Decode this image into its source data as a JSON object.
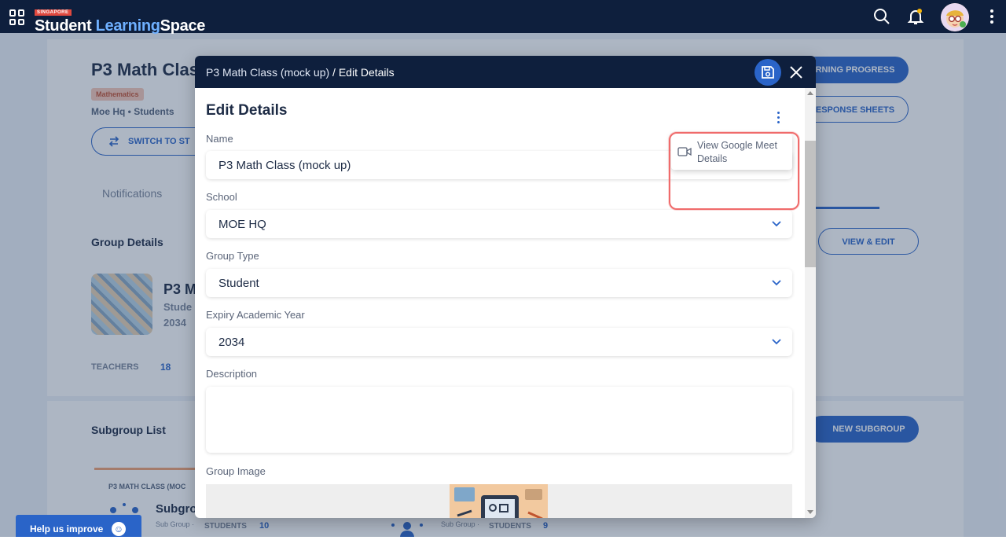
{
  "app": {
    "brand_tag": "SINGAPORE",
    "brand_part1": "Student",
    "brand_part2": "Learning",
    "brand_part3": "Space"
  },
  "background": {
    "group_title": "P3 Math Clas",
    "subject_tag": "Mathematics",
    "meta": "Moe Hq • Students",
    "switch_button": "SWITCH TO ST",
    "learning_progress_button": "RNING PROGRESS",
    "response_sheets_button": "ESPONSE SHEETS",
    "notifications_tab": "Notifications",
    "group_details_heading": "Group Details",
    "group_card_title": "P3 M",
    "group_card_sub1": "Stude",
    "group_card_sub2": "2034",
    "teachers_label": "TEACHERS",
    "teachers_count": "18",
    "view_edit_button": "VIEW & EDIT",
    "subgroup_list_heading": "Subgroup List",
    "new_subgroup_button": "NEW SUBGROUP",
    "subgroup_card_label": "P3 MATH CLASS (MOC",
    "subgroup_card_title": "Subgro",
    "subgroup_card_sub": "Sub Group ·",
    "students_label_1": "STUDENTS",
    "students_count_1": "10",
    "subgroup_card2_sub": "Sub Group ·",
    "students_label_2": "STUDENTS",
    "students_count_2": "9"
  },
  "help": {
    "label": "Help us improve",
    "emoji": "☺"
  },
  "modal": {
    "breadcrumb_parent": "P3 Math Class (mock up)",
    "breadcrumb_separator": " / ",
    "breadcrumb_current": "Edit Details",
    "section_title": "Edit Details",
    "menu_item": "View Google Meet Details",
    "fields": {
      "name_label": "Name",
      "name_value": "P3 Math Class (mock up)",
      "school_label": "School",
      "school_value": "MOE HQ",
      "group_type_label": "Group Type",
      "group_type_value": "Student",
      "expiry_label": "Expiry Academic Year",
      "expiry_value": "2034",
      "description_label": "Description",
      "description_value": "",
      "group_image_label": "Group Image"
    }
  },
  "colors": {
    "topbar": "#0e1f3d",
    "accent": "#2a64c8",
    "highlight": "#f06b6b"
  },
  "icons": [
    "apps-grid-icon",
    "search-icon",
    "bell-icon",
    "avatar",
    "more-vert-icon",
    "save-icon",
    "close-icon",
    "kebab-icon",
    "video-camera-icon",
    "chevron-down-icon",
    "smile-icon"
  ]
}
